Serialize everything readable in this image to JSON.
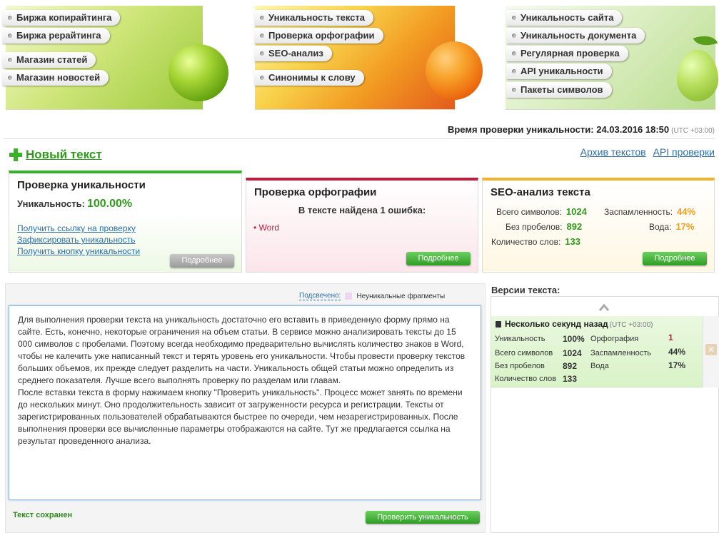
{
  "banners": {
    "left": [
      "Биржа копирайтинга",
      "Биржа рерайтинга",
      "Магазин статей",
      "Магазин новостей"
    ],
    "middle": [
      "Уникальность текста",
      "Проверка орфографии",
      "SEO-анализ",
      "Синонимы к слову"
    ],
    "right": [
      "Уникальность сайта",
      "Уникальность документа",
      "Регулярная проверка",
      "API уникальности",
      "Пакеты символов"
    ]
  },
  "check_time": {
    "label": "Время проверки уникальности: 24.03.2016 18:50",
    "utc": "(UTC +03:00)"
  },
  "new_text": "Новый текст",
  "top_links": {
    "archive": "Архив текстов",
    "api": "API проверки"
  },
  "uniqueness_panel": {
    "title": "Проверка уникальности",
    "label": "Уникальность:",
    "value": "100.00%",
    "links": [
      "Получить ссылку на проверку",
      "Зафиксировать уникальность",
      "Получить кнопку уникальности"
    ],
    "button": "Подробнее"
  },
  "spelling_panel": {
    "title": "Проверка орфографии",
    "found": "В тексте найдена 1 ошибка:",
    "errors": [
      "Word"
    ],
    "button": "Подробнее"
  },
  "seo_panel": {
    "title": "SEO-анализ текста",
    "total_label": "Всего символов:",
    "total": "1024",
    "nospace_label": "Без пробелов:",
    "nospace": "892",
    "words_label": "Количество слов:",
    "words": "133",
    "spam_label": "Заспамленность:",
    "spam": "44%",
    "water_label": "Вода:",
    "water": "17%",
    "button": "Подробнее"
  },
  "editor": {
    "highlighted": "Подсвечено:",
    "legend": "Неуникальные фрагменты",
    "paragraphs": [
      "Для выполнения проверки текста на уникальность достаточно его вставить в приведенную форму прямо на сайте. Есть, конечно, некоторые ограничения на объем статьи. В сервисе можно анализировать тексты до 15 000 символов с пробелами. Поэтому всегда необходимо предварительно вычислять количество знаков в Word, чтобы не калечить уже написанный текст и терять уровень его уникальности. Чтобы провести проверку текстов больших объемов, их прежде следует разделить на части. Уникальность общей статьи можно определить из среднего показателя. Лучше всего выполнять проверку по разделам или главам.",
      "После вставки текста в форму нажимаем кнопку \"Проверить уникальность\". Процесс может занять по времени до нескольких минут. Оно продолжительность зависит от загруженности ресурса и регистрации. Тексты от зарегистрированных пользователей обрабатываются быстрее по очереди, чем незарегистрированных. После выполнения проверки все вычисленные параметры отображаются на сайте. Тут же предлагается ссылка на результат проведенного анализа."
    ],
    "saved": "Текст сохранен",
    "check_button": "Проверить уникальность"
  },
  "versions": {
    "title": "Версии текста:",
    "item": {
      "time": "Несколько секунд назад",
      "utc": "(UTC +03:00)",
      "uniq_label": "Уникальность",
      "uniq": "100%",
      "total_label": "Всего символов",
      "total": "1024",
      "nospace_label": "Без пробелов",
      "nospace": "892",
      "words_label": "Количество слов",
      "words": "133",
      "spell_label": "Орфография",
      "spell": "1",
      "spam_label": "Заспамленность",
      "spam": "44%",
      "water_label": "Вода",
      "water": "17%"
    }
  },
  "colors": {
    "green": "#2f9a1c",
    "red": "#c21c3a",
    "orange": "#f0a020",
    "link": "#2e6ea6"
  }
}
